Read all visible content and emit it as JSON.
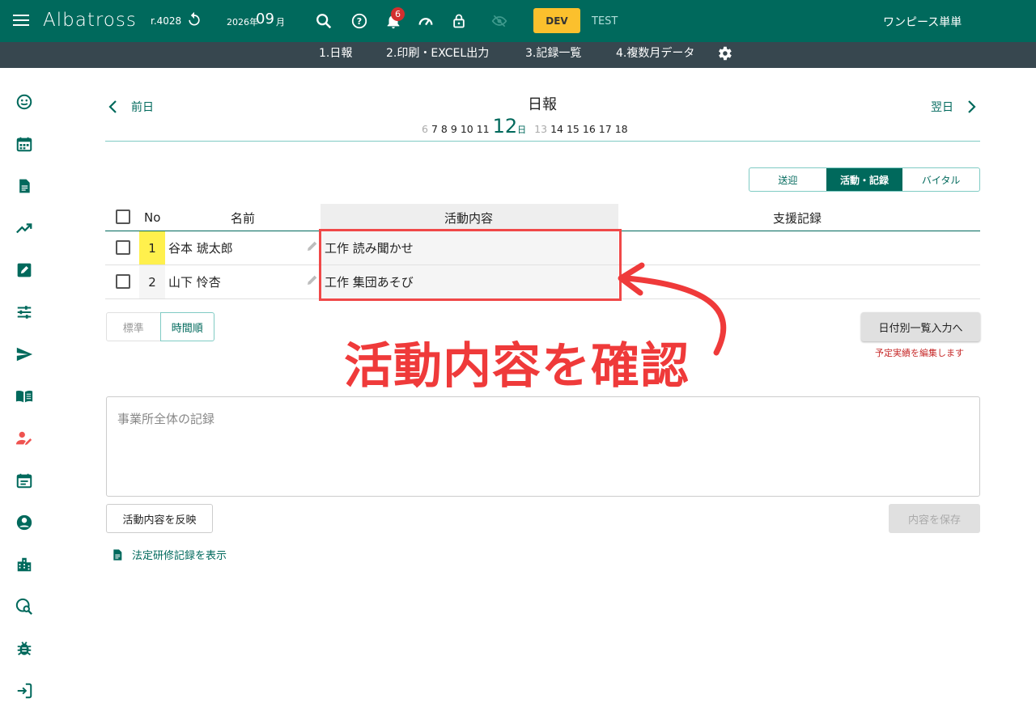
{
  "app": {
    "name": "Albatross",
    "version": "r.4028",
    "year": "2026年",
    "month": "09",
    "month_suffix": "月",
    "notification_count": "6",
    "env_badge": "DEV",
    "env_label": "TEST",
    "user": "ワンピース単単"
  },
  "subnav": [
    "1.日報",
    "2.印刷・EXCEL出力",
    "3.記録一覧",
    "4.複数月データ"
  ],
  "sidebar_icons": [
    "smile-icon",
    "calendar-icon",
    "document-icon",
    "trending-icon",
    "edit-icon",
    "tune-icon",
    "send-icon",
    "book-icon",
    "person-edit-icon",
    "event-icon",
    "account-icon",
    "building-icon",
    "search-location-icon",
    "bug-icon",
    "logout-icon"
  ],
  "nav": {
    "prev": "前日",
    "next": "翌日",
    "title": "日報"
  },
  "dates": {
    "before": [
      "6",
      "7",
      "8",
      "9",
      "10",
      "11"
    ],
    "current": "12",
    "current_suffix": "日",
    "after": [
      "13",
      "14",
      "15",
      "16",
      "17",
      "18"
    ]
  },
  "view_toggle": [
    "送迎",
    "活動・記録",
    "バイタル"
  ],
  "table": {
    "headers": {
      "no": "No",
      "name": "名前",
      "activity": "活動内容",
      "support": "支援記録"
    },
    "rows": [
      {
        "no": "1",
        "name": "谷本 琥太郎",
        "activity": "工作  読み聞かせ"
      },
      {
        "no": "2",
        "name": "山下 怜杏",
        "activity": "工作  集団あそび"
      }
    ]
  },
  "order_toggle": [
    "標準",
    "時間順"
  ],
  "bulk_button": "日付別一覧入力へ",
  "bulk_note": "予定実績を編集します",
  "callout": "活動内容を確認",
  "memo_placeholder": "事業所全体の記録",
  "reflect_button": "活動内容を反映",
  "save_button": "内容を保存",
  "training_link": "法定研修記録を表示",
  "colors": {
    "primary": "#00695c",
    "subnav": "#37474f",
    "accent": "#fbc02d",
    "callout": "#ef3a3a",
    "highlight": "#fff04d"
  }
}
